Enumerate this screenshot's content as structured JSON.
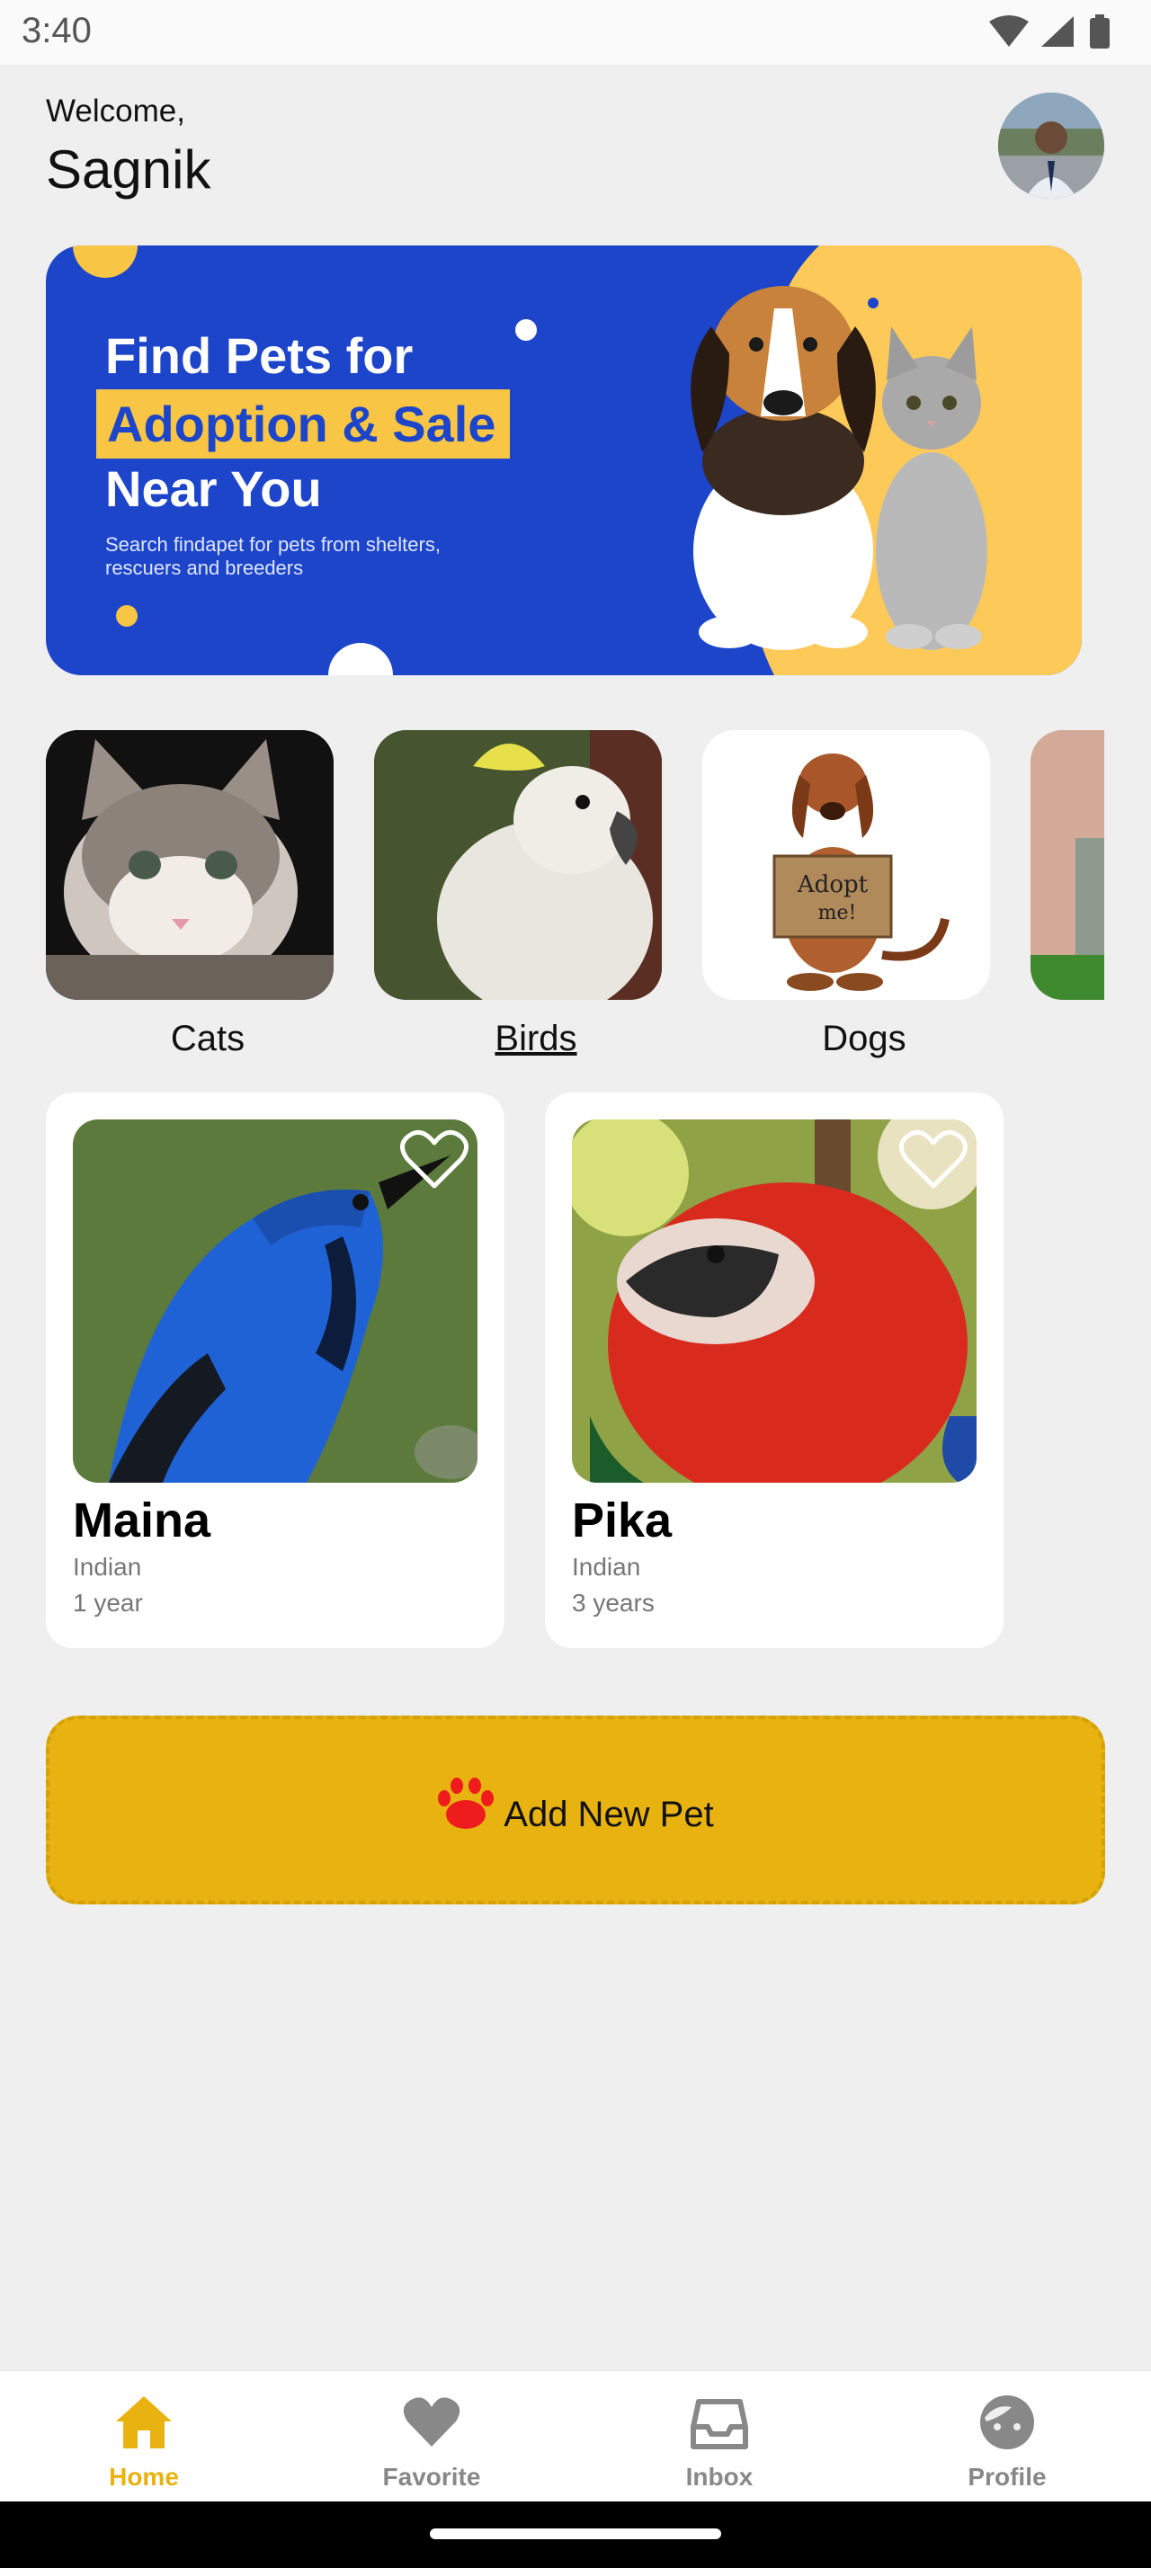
{
  "status_bar": {
    "time": "3:40"
  },
  "header": {
    "welcome": "Welcome,",
    "name": "Sagnik"
  },
  "banner": {
    "line1": "Find Pets for",
    "line2": "Adoption & Sale",
    "line3": "Near You",
    "subtitle": "Search findapet for pets from shelters, rescuers and breeders"
  },
  "categories": [
    {
      "label": "Cats",
      "selected": false
    },
    {
      "label": "Birds",
      "selected": true
    },
    {
      "label": "Dogs",
      "selected": false
    },
    {
      "label": "",
      "selected": false
    }
  ],
  "pets": [
    {
      "name": "Maina",
      "breed": "Indian",
      "age": "1 year",
      "favorited": false
    },
    {
      "name": "Pika",
      "breed": "Indian",
      "age": "3 years",
      "favorited": false
    }
  ],
  "add_pet": {
    "label": "Add New Pet"
  },
  "bottom_nav": [
    {
      "label": "Home",
      "icon": "home-icon",
      "active": true
    },
    {
      "label": "Favorite",
      "icon": "heart-icon",
      "active": false
    },
    {
      "label": "Inbox",
      "icon": "inbox-icon",
      "active": false
    },
    {
      "label": "Profile",
      "icon": "profile-icon",
      "active": false
    }
  ],
  "colors": {
    "accent": "#e8b310",
    "banner_blue": "#1d45c9",
    "banner_yellow": "#f8c545",
    "paw": "#ee1c1c"
  }
}
